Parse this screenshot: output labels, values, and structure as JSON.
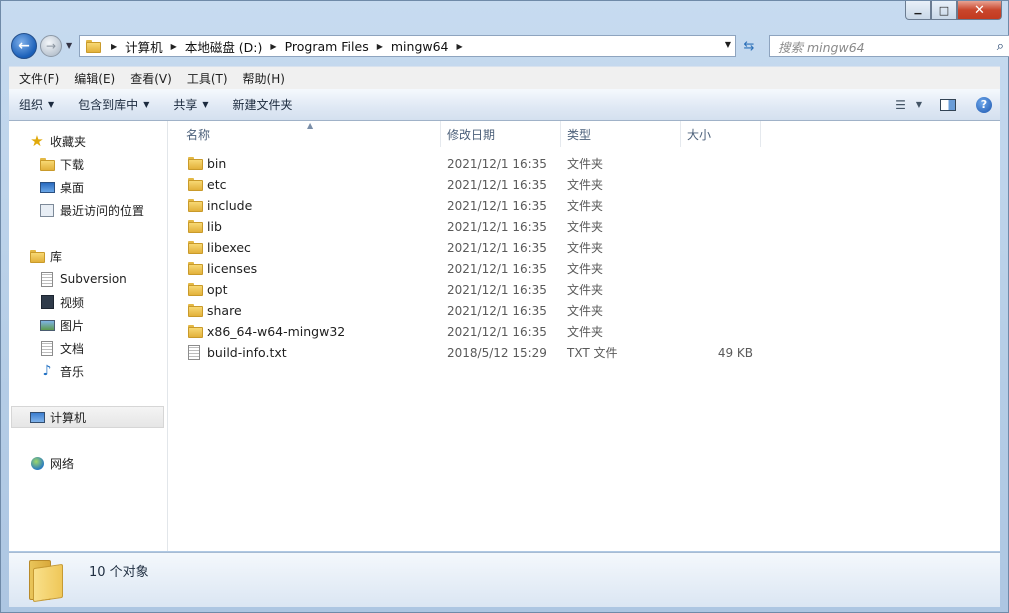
{
  "window": {
    "controls": {
      "minimize": "▁",
      "maximize": "□",
      "close": "✕"
    }
  },
  "address": {
    "breadcrumbs": [
      "计算机",
      "本地磁盘 (D:)",
      "Program Files",
      "mingw64"
    ]
  },
  "search": {
    "placeholder": "搜索 mingw64"
  },
  "menu": [
    "文件(F)",
    "编辑(E)",
    "查看(V)",
    "工具(T)",
    "帮助(H)"
  ],
  "toolbar": {
    "organize": "组织",
    "include_in_library": "包含到库中",
    "share": "共享",
    "new_folder": "新建文件夹"
  },
  "nav": {
    "favorites": {
      "label": "收藏夹",
      "items": [
        "下载",
        "桌面",
        "最近访问的位置"
      ]
    },
    "libraries": {
      "label": "库",
      "items": [
        "Subversion",
        "视频",
        "图片",
        "文档",
        "音乐"
      ]
    },
    "computer": "计算机",
    "network": "网络"
  },
  "columns": {
    "name": "名称",
    "date": "修改日期",
    "type": "类型",
    "size": "大小"
  },
  "files": [
    {
      "name": "bin",
      "date": "2021/12/1 16:35",
      "type": "文件夹",
      "size": "",
      "kind": "folder"
    },
    {
      "name": "etc",
      "date": "2021/12/1 16:35",
      "type": "文件夹",
      "size": "",
      "kind": "folder"
    },
    {
      "name": "include",
      "date": "2021/12/1 16:35",
      "type": "文件夹",
      "size": "",
      "kind": "folder"
    },
    {
      "name": "lib",
      "date": "2021/12/1 16:35",
      "type": "文件夹",
      "size": "",
      "kind": "folder"
    },
    {
      "name": "libexec",
      "date": "2021/12/1 16:35",
      "type": "文件夹",
      "size": "",
      "kind": "folder"
    },
    {
      "name": "licenses",
      "date": "2021/12/1 16:35",
      "type": "文件夹",
      "size": "",
      "kind": "folder"
    },
    {
      "name": "opt",
      "date": "2021/12/1 16:35",
      "type": "文件夹",
      "size": "",
      "kind": "folder"
    },
    {
      "name": "share",
      "date": "2021/12/1 16:35",
      "type": "文件夹",
      "size": "",
      "kind": "folder"
    },
    {
      "name": "x86_64-w64-mingw32",
      "date": "2021/12/1 16:35",
      "type": "文件夹",
      "size": "",
      "kind": "folder"
    },
    {
      "name": "build-info.txt",
      "date": "2018/5/12 15:29",
      "type": "TXT 文件",
      "size": "49 KB",
      "kind": "txt"
    }
  ],
  "status": {
    "count": "10 个对象"
  }
}
